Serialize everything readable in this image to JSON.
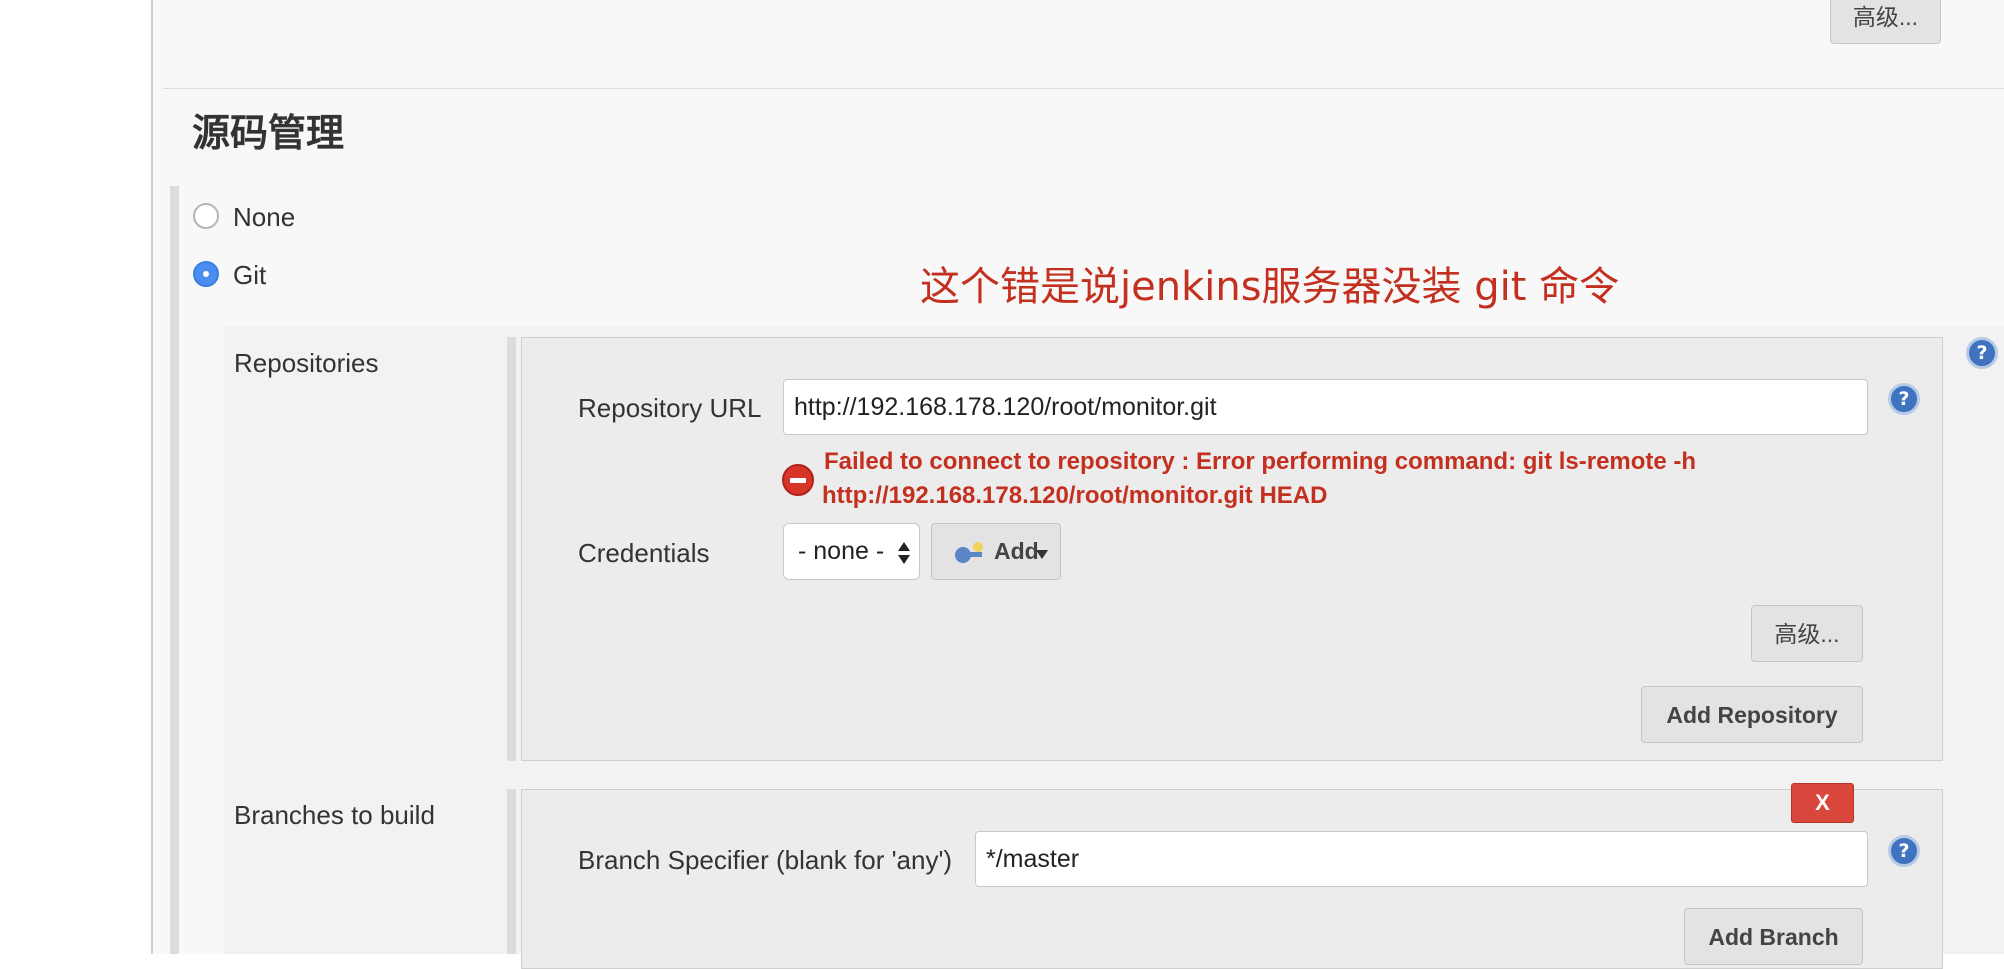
{
  "top": {
    "advanced_label": "高级..."
  },
  "scm": {
    "section_title": "源码管理",
    "options": [
      {
        "label": "None",
        "checked": false
      },
      {
        "label": "Git",
        "checked": true
      }
    ]
  },
  "annotation": {
    "text": "这个错是说jenkins服务器没装 git 命令",
    "color": "#c4301f"
  },
  "repositories": {
    "label": "Repositories",
    "url_label": "Repository URL",
    "url_value": "http://192.168.178.120/root/monitor.git",
    "error_line1": "Failed to connect to repository : Error performing command: git ls-remote -h",
    "error_line2": "http://192.168.178.120/root/monitor.git HEAD",
    "credentials_label": "Credentials",
    "credentials_value": "- none -",
    "add_label": "Add",
    "advanced_label": "高级...",
    "add_repository_label": "Add Repository"
  },
  "branches": {
    "label": "Branches to build",
    "delete_label": "X",
    "specifier_label": "Branch Specifier (blank for 'any')",
    "specifier_value": "*/master",
    "add_branch_label": "Add Branch"
  },
  "icons": {
    "help": "help-icon",
    "error": "error-icon",
    "key": "key-icon",
    "select_arrows": "select-arrows-icon"
  },
  "colors": {
    "error": "#c4301f",
    "radio_checked": "#4a8ef2",
    "help": "#3f73bf",
    "delete": "#d9473c"
  }
}
